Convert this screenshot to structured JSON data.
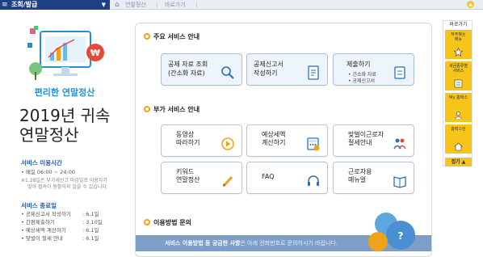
{
  "topbar": {
    "menu_title": "조회/발급",
    "breadcrumb": [
      "연말정산",
      "바로가기"
    ],
    "up_arrow": "▲"
  },
  "left": {
    "hero_sub": "편리한 연말정산",
    "title_line1": "2019년 귀속",
    "title_line2": "연말정산",
    "service_time_title": "서비스 이용시간",
    "service_time": "• 매일 06:00 ~ 24:00",
    "service_note_1": "※1.28일은 부가세신고 마감일로 이용자가",
    "service_note_2": "많아 접속이 원활하지 않을 수 있습니다.",
    "end_title": "서비스 종료일",
    "end_items": [
      {
        "name": "• 공제신고서 작성하기",
        "date": ": 6.1일"
      },
      {
        "name": "• 간편제출하기",
        "date": ": 3.10일"
      },
      {
        "name": "• 예상세액 계산하기",
        "date": ": 6.1일"
      },
      {
        "name": "• 맞벌이 절세 안내",
        "date": ": 6.1일"
      }
    ]
  },
  "main": {
    "section1": "주요 서비스 안내",
    "section2": "부가 서비스 안내",
    "section3": "이용방법 문의",
    "cards_main": [
      {
        "label": "공제 자료 조회\n(간소화 자료)"
      },
      {
        "label": "공제신고서\n작성하기"
      },
      {
        "label": "제출하기",
        "bullets": [
          "• 간소화 자료",
          "• 공제신고서"
        ]
      }
    ],
    "cards_extra": [
      {
        "label": "동영상\n따라하기"
      },
      {
        "label": "예상세액\n계산하기"
      },
      {
        "label": "맞벌이근로자\n절세안내"
      },
      {
        "label": "키워드\n연말정산"
      },
      {
        "label": "FAQ"
      },
      {
        "label": "근로자용\n매뉴얼"
      }
    ],
    "banner_bold": "서비스 이용방법 등 궁금한 사항",
    "banner_rest": "은 아래 전화번호로 문의하시기 바랍니다."
  },
  "quick": {
    "head": "바로가기",
    "items": [
      {
        "label": "자주찾는\n메뉴"
      },
      {
        "label": "세금종류별\n서비스"
      },
      {
        "label": "My 홈택스"
      },
      {
        "label": "홈택스란"
      }
    ],
    "close": "접기 ▲"
  },
  "colors": {
    "nav_blue": "#1d3f86",
    "accent_orange": "#f0a21c",
    "quick_yellow": "#f7c519",
    "hero_blue": "#2a8fd0"
  }
}
